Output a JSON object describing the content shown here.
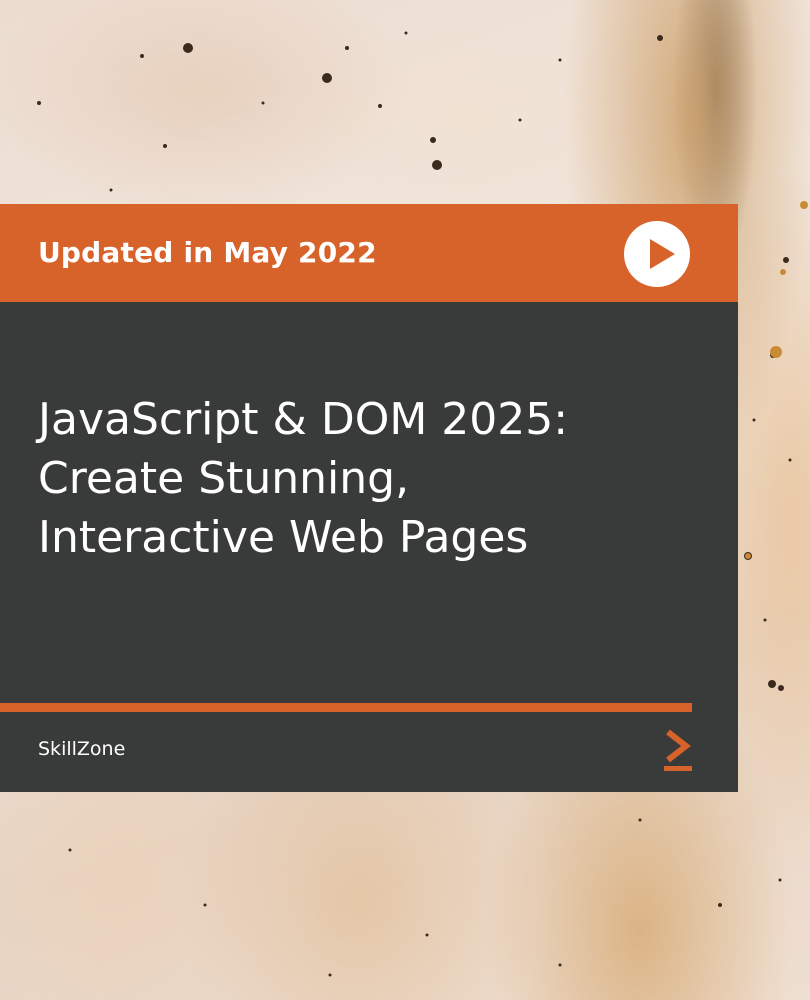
{
  "banner": {
    "updated_label": "Updated in May 2022"
  },
  "course": {
    "title": "JavaScript & DOM 2025: Create Stunning, Interactive Web Pages",
    "brand": "SkillZone"
  },
  "icons": {
    "play": "play-icon",
    "next": "chevron-right-icon"
  },
  "colors": {
    "accent": "#d8632a",
    "panel": "#393b3a",
    "text": "#ffffff"
  }
}
